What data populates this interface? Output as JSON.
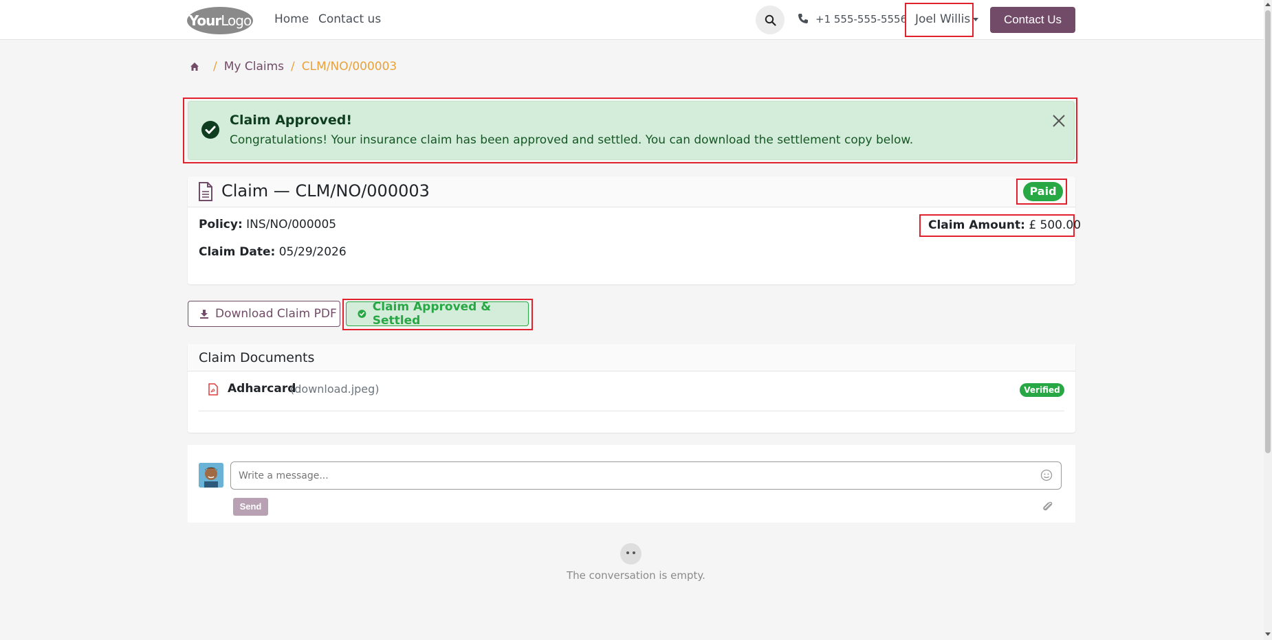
{
  "header": {
    "logo_text_bold": "Your",
    "logo_text": "Logo",
    "nav": [
      "Home",
      "Contact us"
    ],
    "phone": "+1 555-555-5556",
    "user": "Joel Willis",
    "contact_button": "Contact Us"
  },
  "breadcrumb": {
    "separator": "/",
    "items": [
      "My Claims",
      "CLM/NO/000003"
    ]
  },
  "alert": {
    "title": "Claim Approved!",
    "message": "Congratulations! Your insurance claim has been approved and settled. You can download the settlement copy below."
  },
  "claim": {
    "title": "Claim — CLM/NO/000003",
    "status": "Paid",
    "policy_label": "Policy:",
    "policy_value": "INS/NO/000005",
    "date_label": "Claim Date:",
    "date_value": "05/29/2026",
    "amount_label": "Claim Amount:",
    "amount_value": "£ 500.00"
  },
  "actions": {
    "download": "Download Claim PDF",
    "settled": "Claim Approved & Settled"
  },
  "documents": {
    "title": "Claim Documents",
    "items": [
      {
        "name": "Adharcard",
        "file": "(download.jpeg)",
        "status": "Verified"
      }
    ]
  },
  "chatter": {
    "placeholder": "Write a message...",
    "send": "Send",
    "empty": "The conversation is empty."
  },
  "colors": {
    "brand": "#714b67",
    "success": "#28a745",
    "accent": "#e8a23a",
    "highlight": "#e0202a"
  }
}
